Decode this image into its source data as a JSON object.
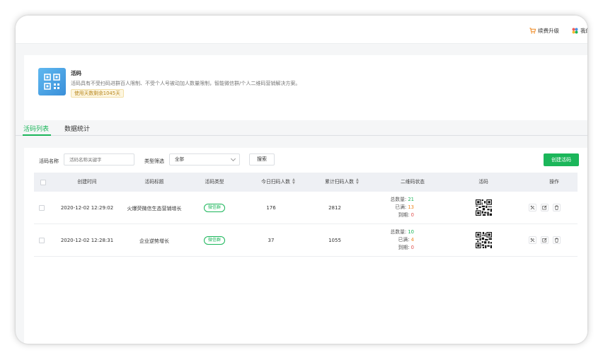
{
  "topbar": {
    "renew_label": "续费升级",
    "user_label": "我的"
  },
  "intro": {
    "title": "活码",
    "description": "活码具有不受扫码进群百人限制、不受个人号被动加人数量限制，智能微信群/个人二维码营销解决方案。",
    "days_remaining": "使用天数剩余1045天"
  },
  "tabs": [
    {
      "label": "活码列表",
      "active": true
    },
    {
      "label": "数据统计",
      "active": false
    }
  ],
  "filters": {
    "name_label": "活码名称",
    "name_placeholder": "活码名称关键字",
    "type_label": "类型筛选",
    "type_value": "全部",
    "search_label": "搜索",
    "create_label": "创建活码"
  },
  "table": {
    "columns": [
      "创建时间",
      "活码标题",
      "活码类型",
      "今日扫码人数",
      "累计扫码人数",
      "二维码状态",
      "活码",
      "操作"
    ],
    "status_labels": {
      "total": "总数量:",
      "full": "已满:",
      "expired": "到期:"
    },
    "rows": [
      {
        "created": "2020-12-02 12:29:02",
        "title": "火爆荧微信生态营销增长",
        "type": "微信群",
        "today_scans": "176",
        "total_scans": "2812",
        "status_total": "21",
        "status_full": "13",
        "status_expired": "0"
      },
      {
        "created": "2020-12-02 12:28:31",
        "title": "企业逆势增长",
        "type": "微信群",
        "today_scans": "37",
        "total_scans": "1055",
        "status_total": "10",
        "status_full": "4",
        "status_expired": "0"
      }
    ]
  },
  "footer": {
    "delete_label": "删除"
  },
  "colors": {
    "accent": "#1bb65a",
    "danger": "#f26b6b",
    "warning": "#f08a24"
  }
}
